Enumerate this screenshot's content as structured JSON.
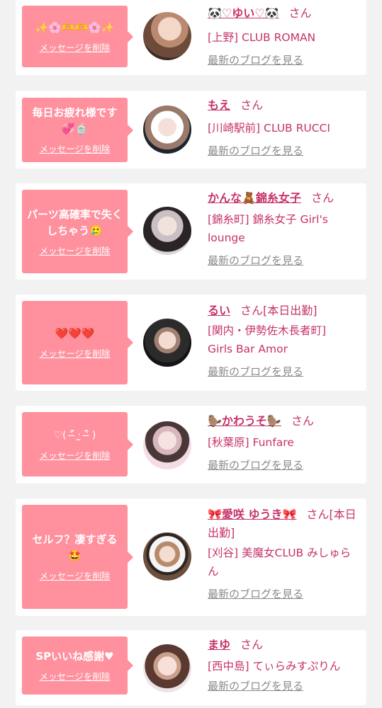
{
  "delete_label": "メッセージを削除",
  "blog_label": "最新のブログを見る",
  "san_label": "さん",
  "colors": {
    "accent_pink": "#ff909e",
    "name_pink": "#c6326a",
    "link_gray": "#8a8a8a",
    "background": "#f2f2f2"
  },
  "cards": [
    {
      "message": "✨🌸🫶🫶🌸✨",
      "name": "🐼♡ゆい♡🐼",
      "extra": "",
      "shop": "[上野] CLUB ROMAN"
    },
    {
      "message": "毎日お疲れ様です💞🍵",
      "name": "もえ",
      "extra": "",
      "shop": "[川崎駅前] CLUB RUCCI"
    },
    {
      "message": "パーツ高確率で失くしちゃう🥲",
      "name": "かんな🧸錦糸女子",
      "extra": "",
      "shop": "[錦糸町] 錦糸女子 Girl's lounge"
    },
    {
      "message": "❤️❤️❤️",
      "name": "るい",
      "extra": "[本日出勤]",
      "shop": "[関内・伊勢佐木長者町] Girls Bar Amor"
    },
    {
      "message": "♡( ˃̶᷇ ‧̫ ˂̶᷆ )",
      "name": "🦫かわうそ🦫",
      "extra": "",
      "shop": "[秋葉原] Funfare"
    },
    {
      "message": "セルフ？凄すぎる🤩",
      "name": "🎀愛咲 ゆうき🎀",
      "extra": "[本日出勤]",
      "shop": "[刈谷] 美魔女CLUB みしゅらん"
    },
    {
      "message": "SPいいね感謝♥",
      "name": "まゆ",
      "extra": "",
      "shop": "[西中島] てぃらみすぷりん"
    }
  ]
}
